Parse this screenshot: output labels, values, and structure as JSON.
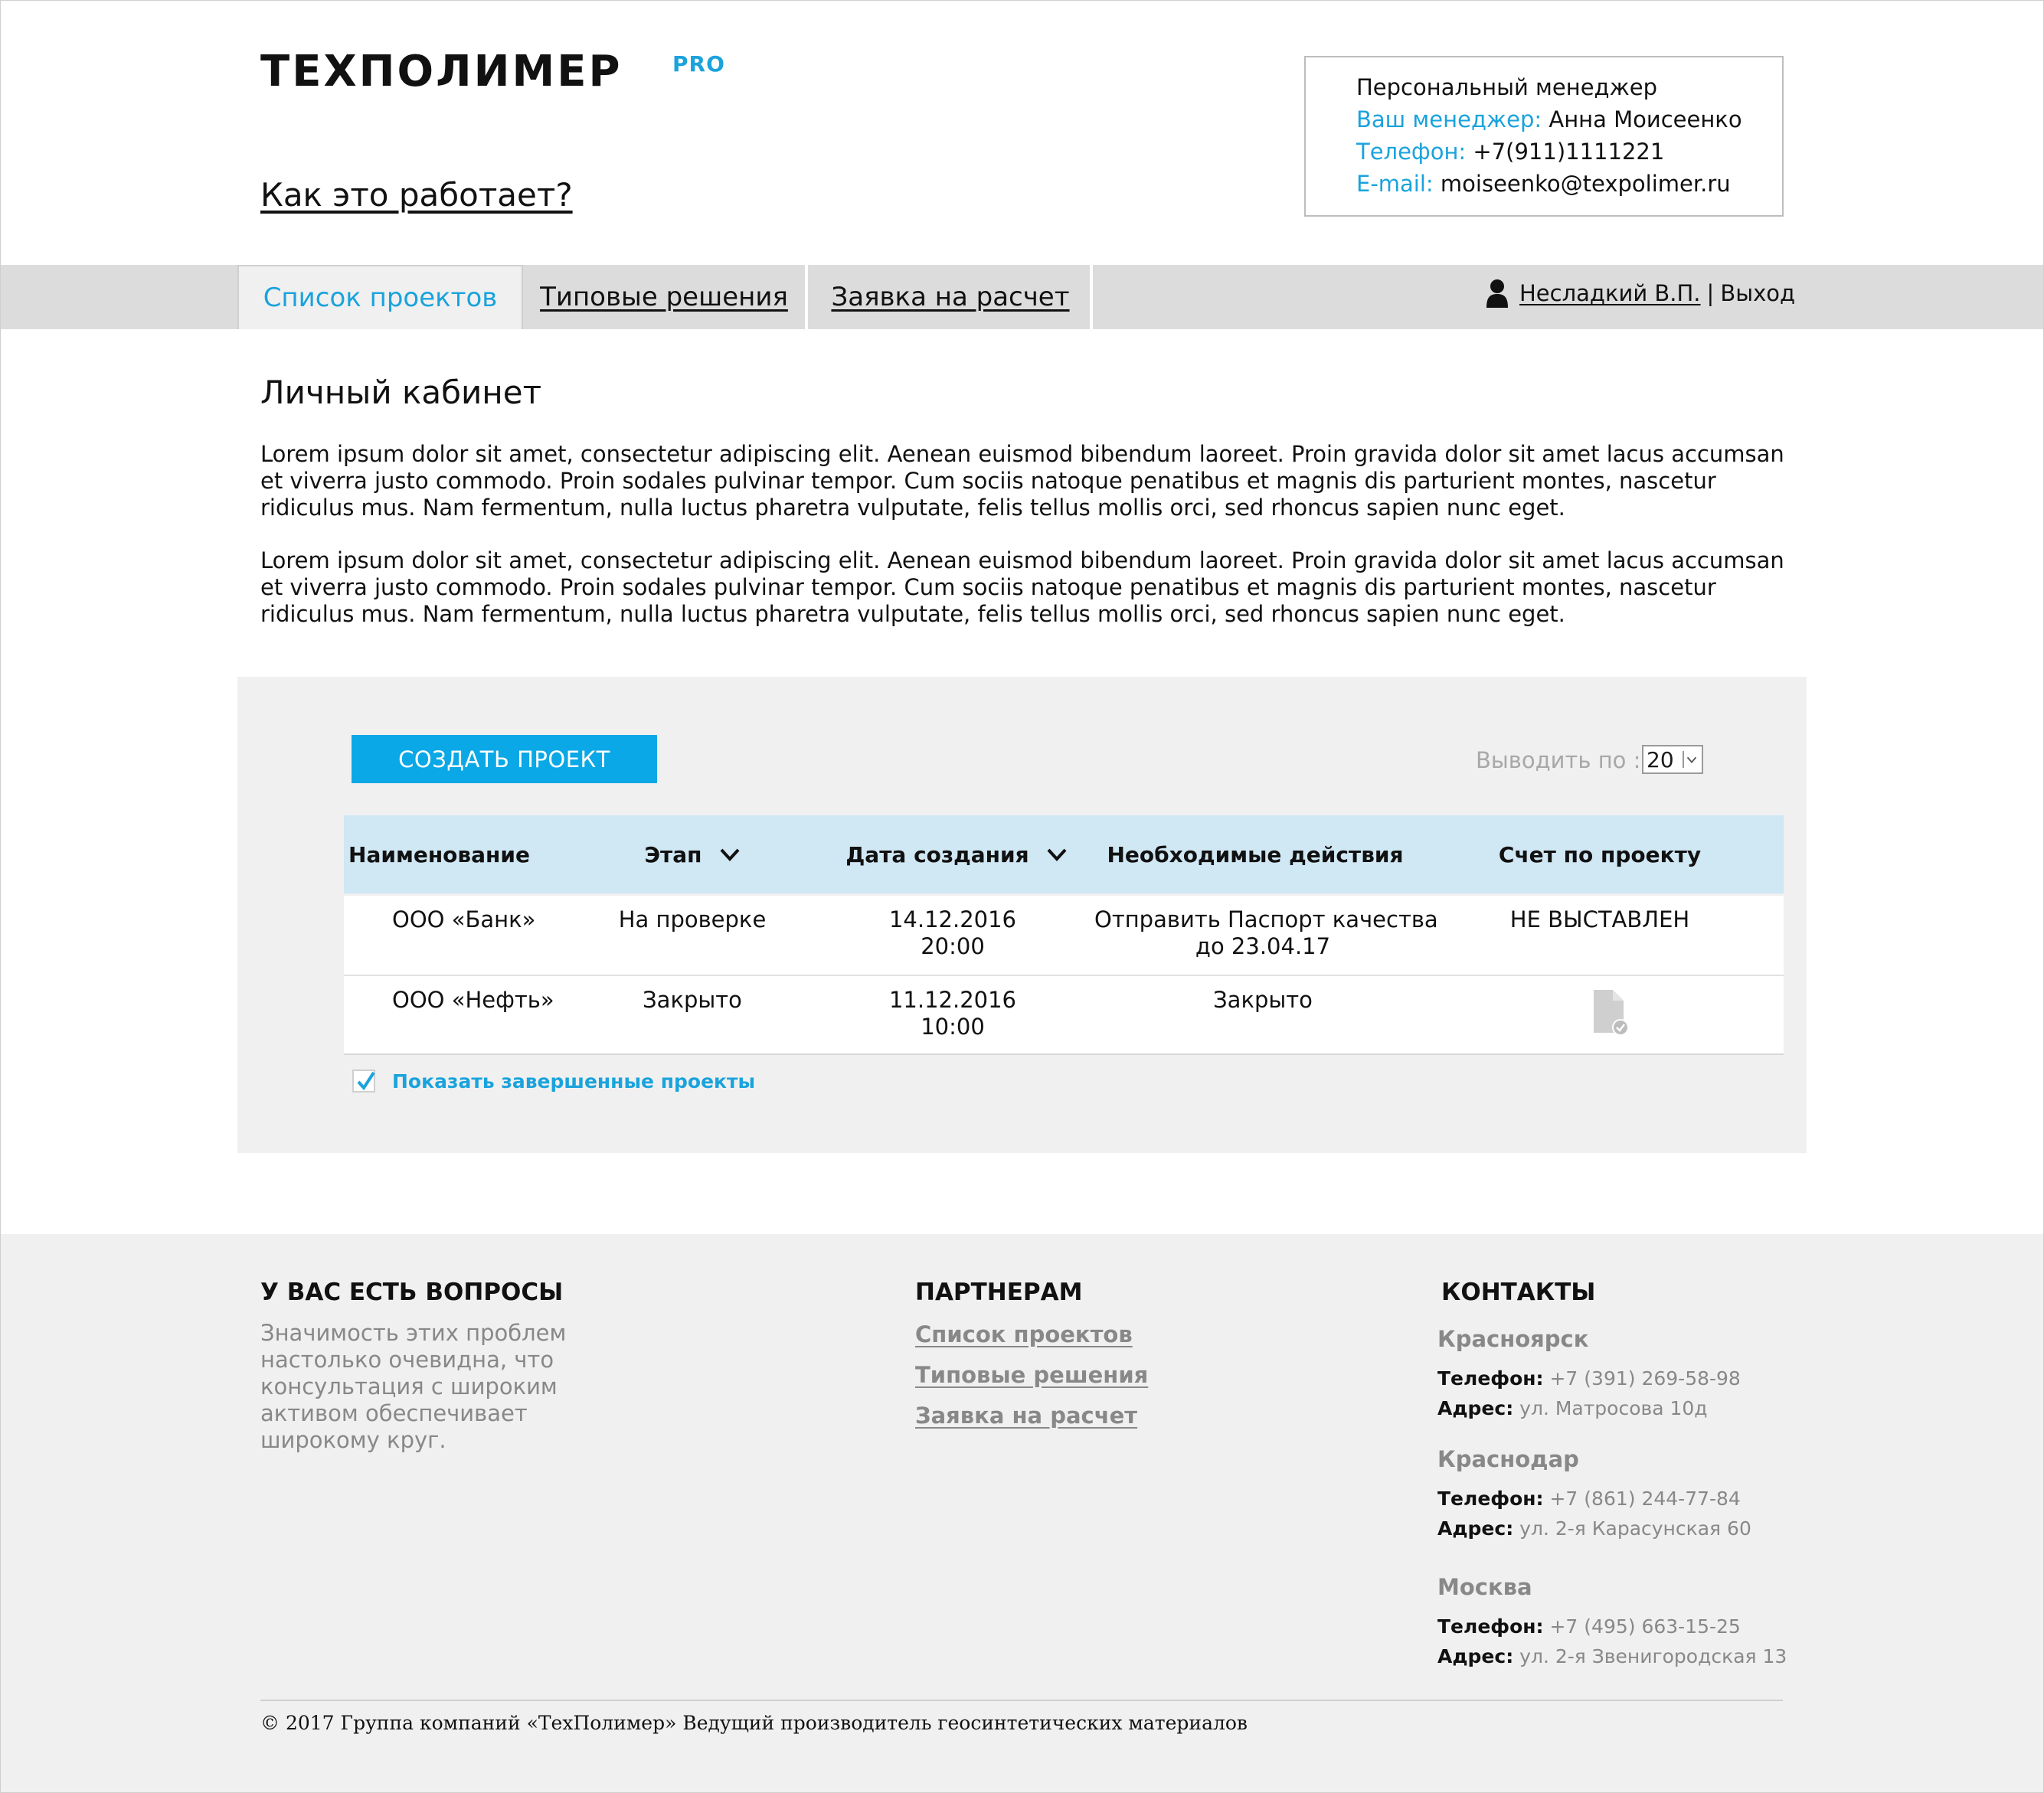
{
  "header": {
    "logo_text": "ТЕХПОЛИМЕР",
    "logo_suffix": "PRO",
    "how_it_works": "Как это работает?"
  },
  "manager": {
    "title": "Персональный менеджер",
    "name_key": "Ваш менеджер:",
    "name_value": "Анна Моисеенко",
    "phone_key": "Телефон:",
    "phone_value": "+7(911)1111221",
    "email_key": "E-mail:",
    "email_value": "moiseenko@texpolimer.ru"
  },
  "nav": {
    "tabs": [
      "Список проектов",
      "Типовые решения",
      "Заявка на расчет"
    ],
    "active_tab": 0,
    "user_name": "Несладкий В.П.",
    "separator": "|",
    "logout": "Выход"
  },
  "main": {
    "title": "Личный кабинет",
    "paragraphs": [
      "Lorem ipsum dolor sit amet, consectetur adipiscing elit. Aenean euismod bibendum laoreet. Proin gravida dolor sit amet lacus accumsan et viverra justo commodo. Proin sodales pulvinar tempor. Cum sociis natoque penatibus et magnis dis parturient montes, nascetur ridiculus mus. Nam fermentum, nulla luctus pharetra vulputate, felis tellus mollis orci, sed rhoncus sapien nunc eget.",
      "Lorem ipsum dolor sit amet, consectetur adipiscing elit. Aenean euismod bibendum laoreet. Proin gravida dolor sit amet lacus accumsan et viverra justo commodo. Proin sodales pulvinar tempor. Cum sociis natoque penatibus et magnis dis parturient montes, nascetur ridiculus mus. Nam fermentum, nulla luctus pharetra vulputate, felis tellus mollis orci, sed rhoncus sapien nunc eget."
    ]
  },
  "projects": {
    "create_button": "СОЗДАТЬ ПРОЕКТ",
    "per_page_label": "Выводить по :",
    "per_page_value": "20",
    "columns": [
      "Наименование",
      "Этап",
      "Дата создания",
      "Необходимые действия",
      "Счет по проекту"
    ],
    "rows": [
      {
        "name": "ООО «Банк»",
        "stage": "На проверке",
        "date": "14.12.2016",
        "time": "20:00",
        "action_line1": "Отправить Паспорт качества",
        "action_line2": "до 23.04.17",
        "invoice": "НЕ ВЫСТАВЛЕН",
        "invoice_icon": ""
      },
      {
        "name": "ООО «Нефть»",
        "stage": "Закрыто",
        "date": "11.12.2016",
        "time": "10:00",
        "action_line1": "Закрыто",
        "action_line2": "",
        "invoice": "",
        "invoice_icon": "document-check-icon"
      }
    ],
    "show_completed_label": "Показать завершенные проекты",
    "show_completed_checked": true
  },
  "footer": {
    "questions": {
      "heading": "У ВАС ЕСТЬ ВОПРОСЫ",
      "text": "Значимость этих проблем настолько очевидна, что консультация с широким активом обеспечивает широкому круг."
    },
    "partners": {
      "heading": "ПАРТНЕРАМ",
      "links": [
        "Список проектов",
        "Типовые решения",
        "Заявка на расчет"
      ]
    },
    "contacts": {
      "heading": "КОНТАКТЫ",
      "phone_key": "Телефон:",
      "address_key": "Адрес:",
      "cities": [
        {
          "city": "Красноярск",
          "phone": "+7 (391) 269-58-98",
          "address": "ул. Матросова 10д"
        },
        {
          "city": "Краснодар",
          "phone": "+7 (861) 244-77-84",
          "address": "ул. 2-я Карасунская 60"
        },
        {
          "city": "Москва",
          "phone": "+7 (495) 663-15-25",
          "address": "ул. 2-я Звенигородская 13"
        }
      ]
    },
    "copyright": "© 2017 Группа компаний «ТехПолимер» Ведущий производитель геосинтетических материалов"
  },
  "colors": {
    "accent": "#1aa3dc",
    "button": "#0aa8e6",
    "table_header": "#d0e7f4",
    "panel": "#f0f0f0",
    "navbar": "#dcdcdc"
  }
}
